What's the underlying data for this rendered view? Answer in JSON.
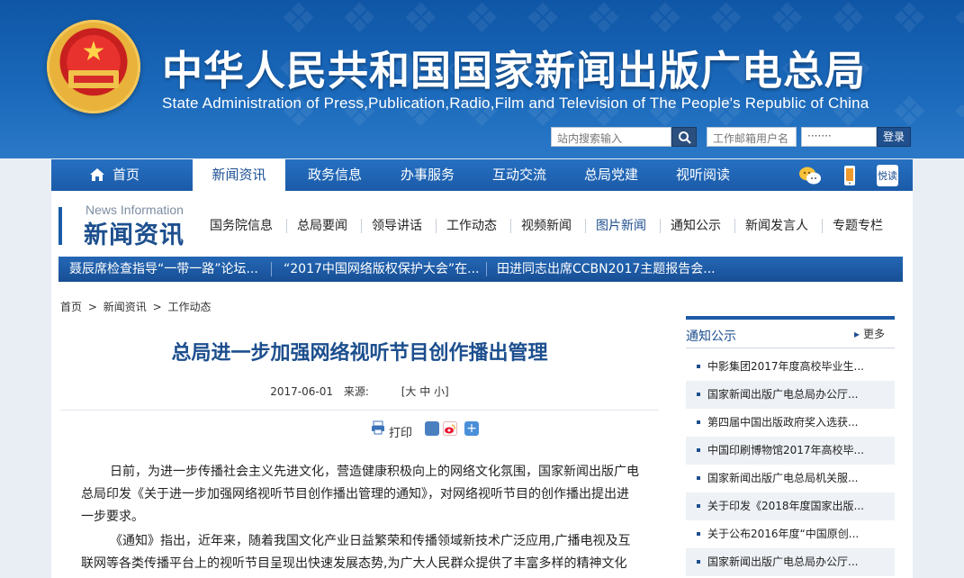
{
  "site": {
    "title_cn": "中华人民共和国国家新闻出版广电总局",
    "title_en": "State Administration of Press,Publication,Radio,Film and Television of The People's Republic of China"
  },
  "search": {
    "placeholder": "站内搜索输入"
  },
  "login": {
    "email_placeholder": "工作邮箱用户名",
    "password_value": "·······",
    "button_label": "登录"
  },
  "main_nav": {
    "items": [
      {
        "label": "首页"
      },
      {
        "label": "新闻资讯"
      },
      {
        "label": "政务信息"
      },
      {
        "label": "办事服务"
      },
      {
        "label": "互动交流"
      },
      {
        "label": "总局党建"
      },
      {
        "label": "视听阅读"
      }
    ],
    "active": "新闻资讯",
    "icons": [
      "wechat-icon",
      "mobile-icon",
      "reading-icon"
    ],
    "reading_icon_text": "悦读"
  },
  "section": {
    "title_en": "News Information",
    "title_cn": "新闻资讯"
  },
  "sub_nav": {
    "items": [
      {
        "label": "国务院信息"
      },
      {
        "label": "总局要闻"
      },
      {
        "label": "领导讲话"
      },
      {
        "label": "工作动态"
      },
      {
        "label": "视频新闻"
      },
      {
        "label": "图片新闻"
      },
      {
        "label": "通知公示"
      },
      {
        "label": "新闻发言人"
      },
      {
        "label": "专题专栏"
      }
    ],
    "active": "图片新闻"
  },
  "ticker": {
    "items": [
      {
        "text": "聂辰席检查指导“一带一路”论坛..."
      },
      {
        "text": "“2017中国网络版权保护大会”在..."
      },
      {
        "text": "田进同志出席CCBN2017主题报告会..."
      }
    ]
  },
  "breadcrumb": {
    "items": [
      "首页",
      ">",
      "新闻资讯",
      ">",
      "工作动态"
    ]
  },
  "article": {
    "title": "总局进一步加强网络视听节目创作播出管理",
    "date": "2017-06-01",
    "source_label": "来源:",
    "font_size_label": "[大 中 小]",
    "print_label": "打印",
    "paragraphs": [
      "日前，为进一步传播社会主义先进文化，营造健康积极向上的网络文化氛围，国家新闻出版广电总局印发《关于进一步加强网络视听节目创作播出管理的通知》，对网络视听节目的创作播出提出进一步要求。",
      "《通知》指出，近年来，随着我国文化产业日益繁荣和传播领域新技术广泛应用,广播电视及互联网等各类传播平台上的视听节目呈现出快速发展态势,为广大人民群众提供了丰富多样的精神文化产"
    ]
  },
  "sidebar": {
    "title": "通知公示",
    "more_label": "更多",
    "items": [
      {
        "text": "中影集团2017年度高校毕业生..."
      },
      {
        "text": "国家新闻出版广电总局办公厅..."
      },
      {
        "text": "第四届中国出版政府奖入选获..."
      },
      {
        "text": "中国印刷博物馆2017年高校毕..."
      },
      {
        "text": "国家新闻出版广电总局机关服..."
      },
      {
        "text": "关于印发《2018年度国家出版..."
      },
      {
        "text": "关于公布2016年度“中国原创..."
      },
      {
        "text": "国家新闻出版广电总局办公厅..."
      }
    ]
  },
  "colors": {
    "brand_blue": "#1b5ba8",
    "title_blue": "#1d4f8e",
    "banner_blue": "#1a68ba",
    "emblem_red": "#d62a2a",
    "emblem_gold": "#f0c24a"
  }
}
